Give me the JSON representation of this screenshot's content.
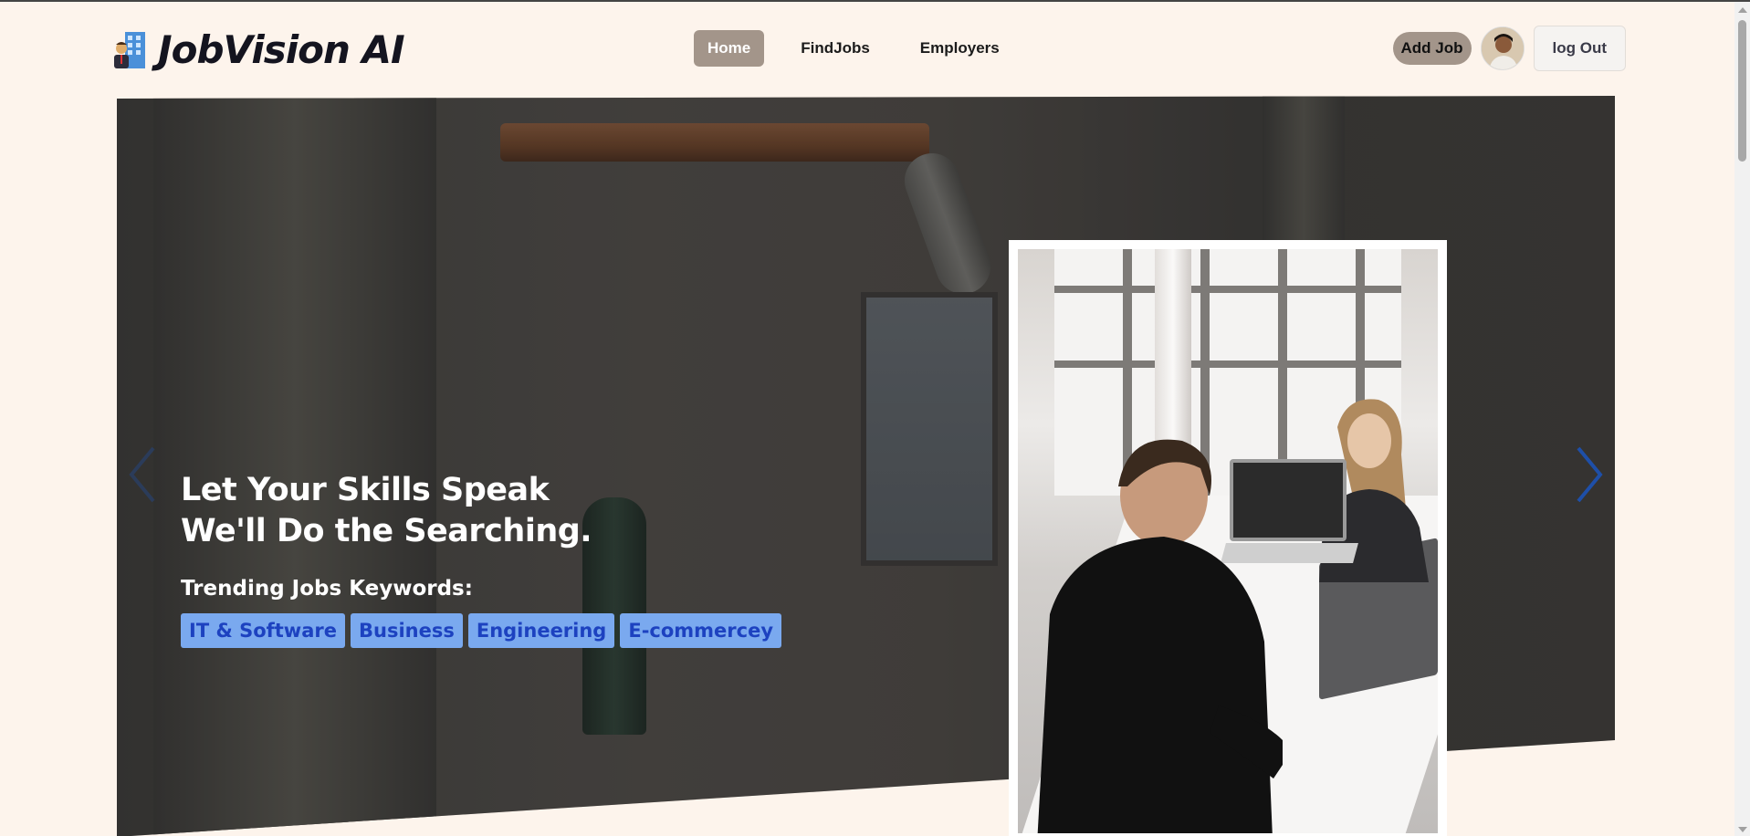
{
  "header": {
    "logo_text": "JobVision AI",
    "logo_icon": "office-worker-building-icon",
    "nav": [
      {
        "label": "Home",
        "active": true
      },
      {
        "label": "FindJobs",
        "active": false
      },
      {
        "label": "Employers",
        "active": false
      }
    ],
    "add_job_label": "Add Job",
    "avatar_icon": "user-avatar",
    "logout_label": "log Out"
  },
  "hero": {
    "headline_line1": "Let Your Skills Speak",
    "headline_line2": "We'll Do the Searching.",
    "trending_title": "Trending Jobs Keywords:",
    "keywords": [
      "IT & Software",
      "Business",
      "Engineering",
      "E-commercey"
    ],
    "prev_icon": "chevron-left-icon",
    "next_icon": "chevron-right-icon"
  },
  "colors": {
    "background": "#fdf4ec",
    "nav_active": "#a3958a",
    "chip_bg": "#7aa9ef",
    "chip_text": "#1d42c0",
    "arrow": "#1e4fa8"
  }
}
